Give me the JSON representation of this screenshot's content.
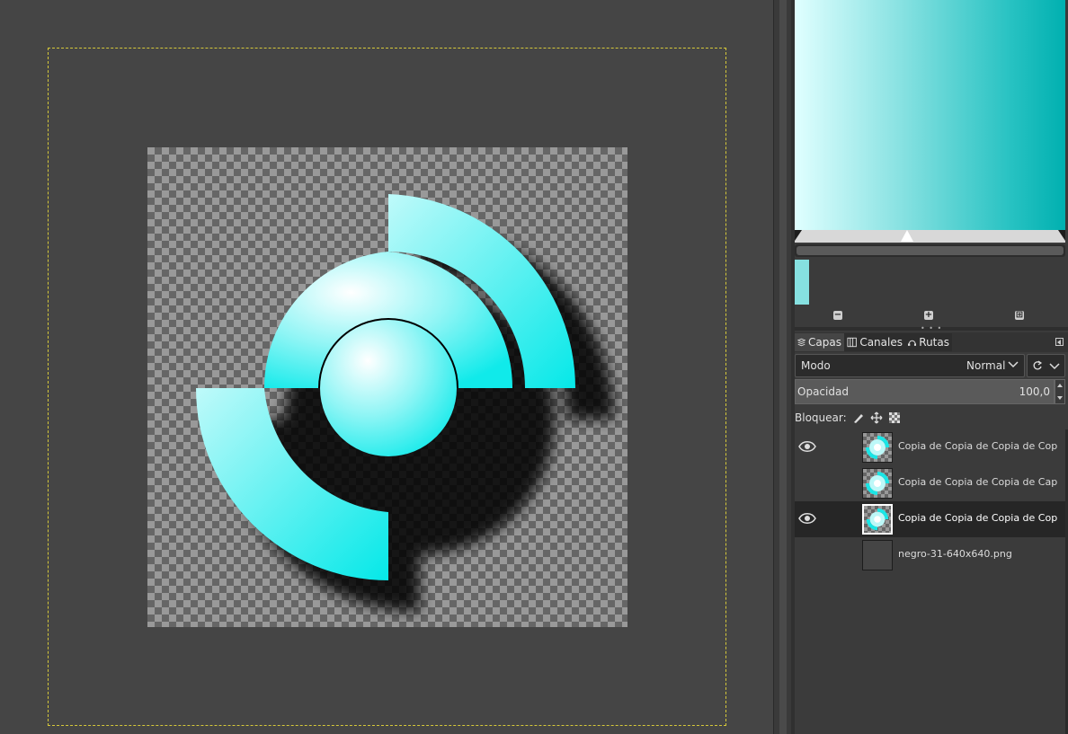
{
  "canvas": {
    "layer_icon": "fracture-circle-logo",
    "accent_color": "#00e5e5"
  },
  "gradient_editor": {
    "swatch_color": "#86e1e1",
    "buttons": [
      "zoom-out-icon",
      "zoom-in-icon",
      "zoom-fit-icon"
    ]
  },
  "tabs": [
    {
      "label": "Capas",
      "icon": "layers-icon"
    },
    {
      "label": "Canales",
      "icon": "channels-icon"
    },
    {
      "label": "Rutas",
      "icon": "paths-icon"
    }
  ],
  "layers_panel": {
    "mode_label": "Modo",
    "mode_value": "Normal",
    "opacity_label": "Opacidad",
    "opacity_value": "100,0",
    "lock_label": "Bloquear:",
    "layers": [
      {
        "name": "Copia de Copia de Copia de Cop",
        "visible": true,
        "selected": false,
        "thumb": "logo"
      },
      {
        "name": "Copia de Copia de Copia de Cap",
        "visible": false,
        "selected": false,
        "thumb": "logo"
      },
      {
        "name": "Copia de Copia de Copia de Cop",
        "visible": true,
        "selected": true,
        "thumb": "logo"
      },
      {
        "name": "negro-31-640x640.png",
        "visible": false,
        "selected": false,
        "thumb": "dark"
      }
    ]
  }
}
